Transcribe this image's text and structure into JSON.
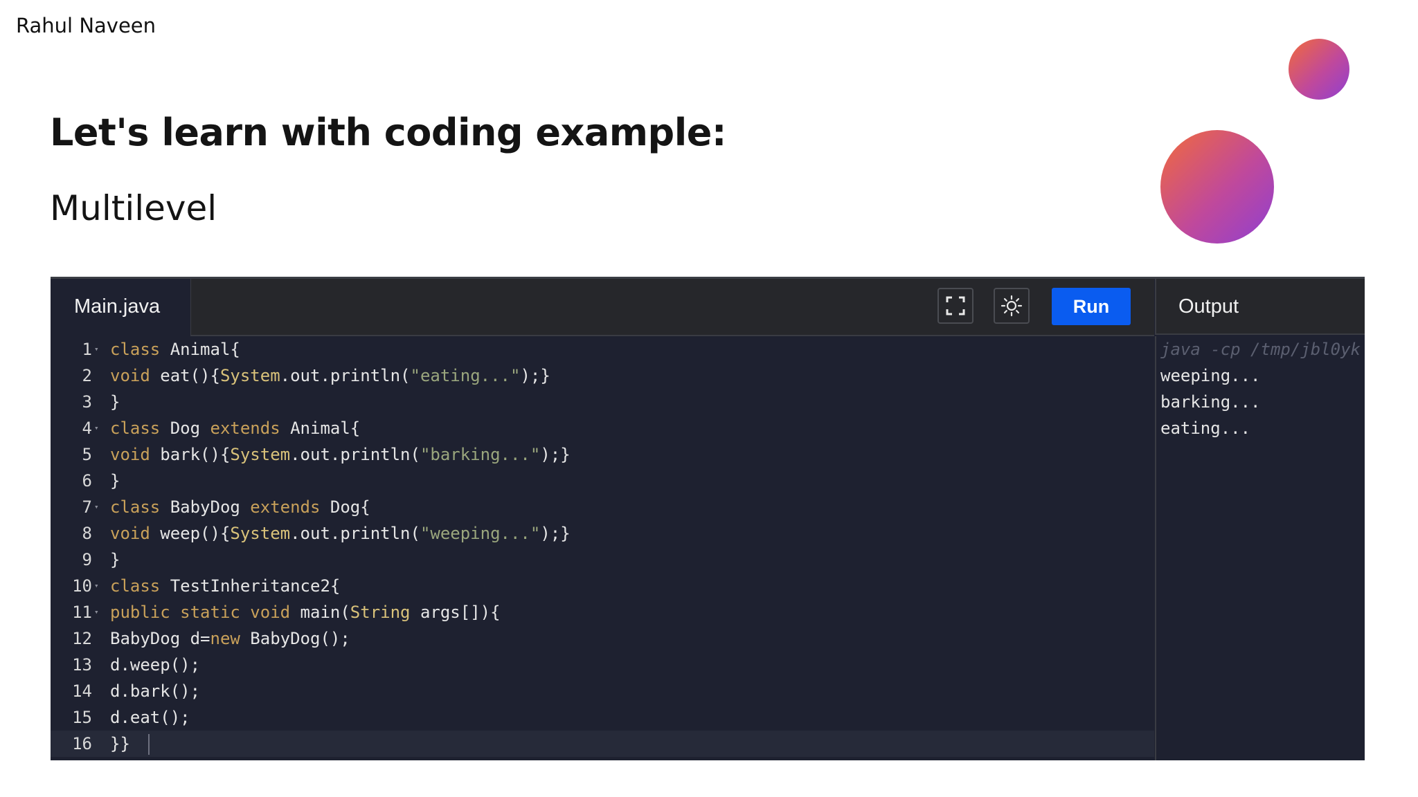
{
  "author": "Rahul Naveen",
  "heading": "Let's learn with coding example:",
  "subheading": "Multilevel",
  "ide": {
    "file_tab": "Main.java",
    "expand_icon": "expand-icon",
    "theme_icon": "sun-icon",
    "run_label": "Run",
    "output_label": "Output",
    "colors": {
      "run_button": "#0a5cf0",
      "background": "#1e2130",
      "keyword": "#c9a15a",
      "string": "#9aa67d"
    },
    "code_lines": [
      {
        "num": "1",
        "segs": [
          {
            "t": "class",
            "c": "kw"
          },
          {
            "t": " Animal{",
            "c": ""
          }
        ]
      },
      {
        "num": "2",
        "segs": [
          {
            "t": "void",
            "c": "kw"
          },
          {
            "t": " eat(){",
            "c": ""
          },
          {
            "t": "System",
            "c": "ty"
          },
          {
            "t": ".out.println(",
            "c": ""
          },
          {
            "t": "\"eating...\"",
            "c": "st"
          },
          {
            "t": ");}",
            "c": ""
          }
        ]
      },
      {
        "num": "3",
        "segs": [
          {
            "t": "}",
            "c": ""
          }
        ]
      },
      {
        "num": "4",
        "segs": [
          {
            "t": "class",
            "c": "kw"
          },
          {
            "t": " Dog ",
            "c": ""
          },
          {
            "t": "extends",
            "c": "kw"
          },
          {
            "t": " Animal{",
            "c": ""
          }
        ]
      },
      {
        "num": "5",
        "segs": [
          {
            "t": "void",
            "c": "kw"
          },
          {
            "t": " bark(){",
            "c": ""
          },
          {
            "t": "System",
            "c": "ty"
          },
          {
            "t": ".out.println(",
            "c": ""
          },
          {
            "t": "\"barking...\"",
            "c": "st"
          },
          {
            "t": ");}",
            "c": ""
          }
        ]
      },
      {
        "num": "6",
        "segs": [
          {
            "t": "}",
            "c": ""
          }
        ]
      },
      {
        "num": "7",
        "segs": [
          {
            "t": "class",
            "c": "kw"
          },
          {
            "t": " BabyDog ",
            "c": ""
          },
          {
            "t": "extends",
            "c": "kw"
          },
          {
            "t": " Dog{",
            "c": ""
          }
        ]
      },
      {
        "num": "8",
        "segs": [
          {
            "t": "void",
            "c": "kw"
          },
          {
            "t": " weep(){",
            "c": ""
          },
          {
            "t": "System",
            "c": "ty"
          },
          {
            "t": ".out.println(",
            "c": ""
          },
          {
            "t": "\"weeping...\"",
            "c": "st"
          },
          {
            "t": ");}",
            "c": ""
          }
        ]
      },
      {
        "num": "9",
        "segs": [
          {
            "t": "}",
            "c": ""
          }
        ]
      },
      {
        "num": "10",
        "segs": [
          {
            "t": "class",
            "c": "kw"
          },
          {
            "t": " TestInheritance2{",
            "c": ""
          }
        ]
      },
      {
        "num": "11",
        "segs": [
          {
            "t": "public static void",
            "c": "kw"
          },
          {
            "t": " main(",
            "c": ""
          },
          {
            "t": "String",
            "c": "ty"
          },
          {
            "t": " args[]){",
            "c": ""
          }
        ]
      },
      {
        "num": "12",
        "segs": [
          {
            "t": "BabyDog d=",
            "c": ""
          },
          {
            "t": "new",
            "c": "kw"
          },
          {
            "t": " BabyDog();",
            "c": ""
          }
        ]
      },
      {
        "num": "13",
        "segs": [
          {
            "t": "d.weep();",
            "c": ""
          }
        ]
      },
      {
        "num": "14",
        "segs": [
          {
            "t": "d.bark();",
            "c": ""
          }
        ]
      },
      {
        "num": "15",
        "segs": [
          {
            "t": "d.eat();",
            "c": ""
          }
        ]
      },
      {
        "num": "16",
        "segs": [
          {
            "t": "}}",
            "c": ""
          }
        ]
      }
    ],
    "output_lines": [
      {
        "t": "java -cp /tmp/jbl0yk",
        "cmd": true
      },
      {
        "t": "weeping...",
        "cmd": false
      },
      {
        "t": "barking...",
        "cmd": false
      },
      {
        "t": "eating...",
        "cmd": false
      }
    ]
  }
}
